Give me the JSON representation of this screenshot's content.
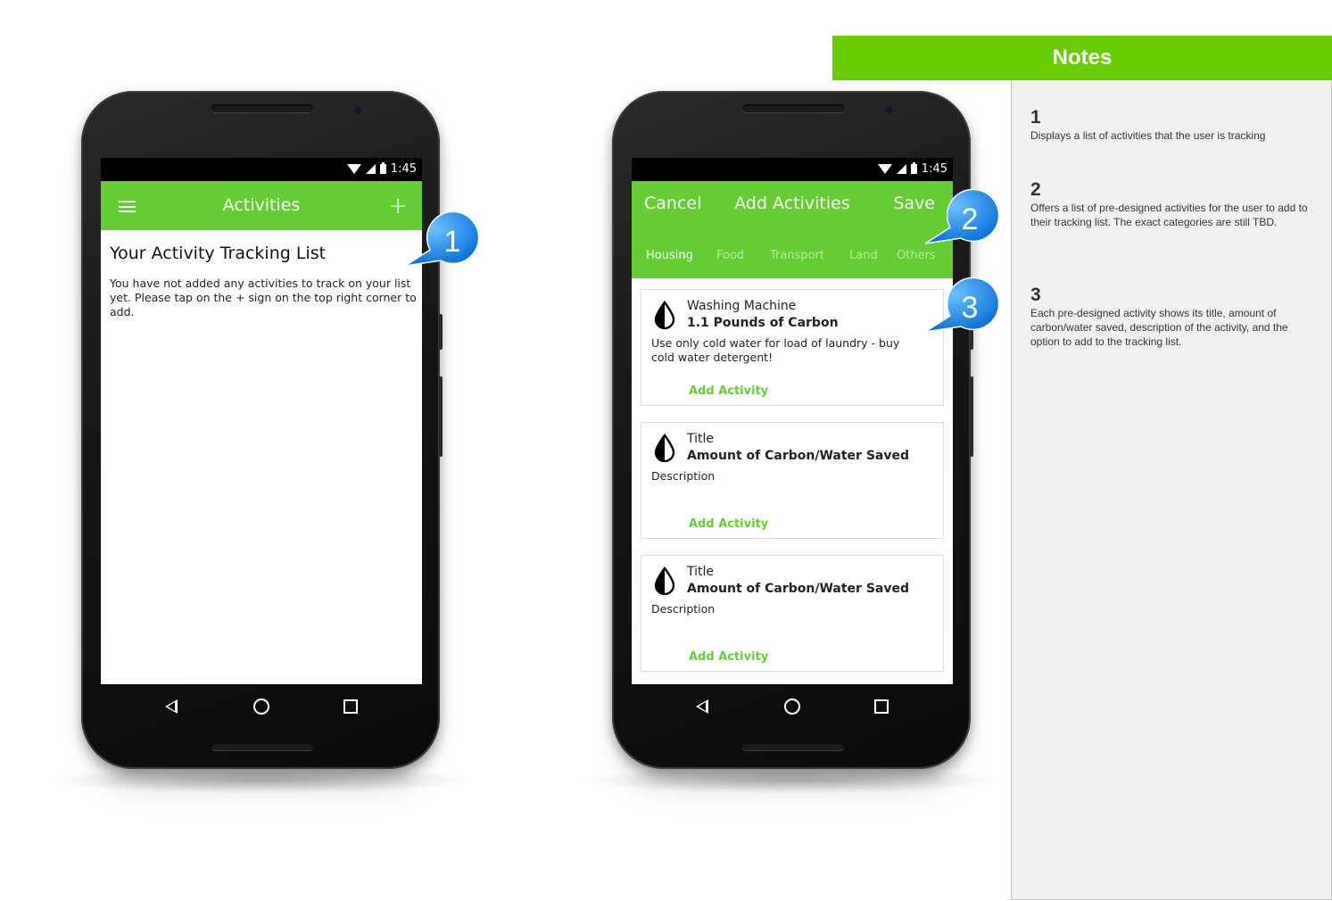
{
  "status": {
    "time": "1:45"
  },
  "screen1": {
    "title": "Activities",
    "heading": "Your Activity Tracking List",
    "message": "You have not added any activities to track on your list yet. Please tap on the + sign on the top right corner to add."
  },
  "screen2": {
    "title": "Add Activities",
    "cancel_label": "Cancel",
    "save_label": "Save",
    "tabs": [
      {
        "label": "Housing"
      },
      {
        "label": "Food"
      },
      {
        "label": "Transport"
      },
      {
        "label": "Land"
      },
      {
        "label": "Others"
      }
    ],
    "cards": [
      {
        "title": "Washing Machine",
        "amount": "1.1 Pounds of Carbon",
        "description": "Use only cold water for load of laundry - buy cold water detergent!",
        "action": "Add Activity"
      },
      {
        "title": "Title",
        "amount": "Amount of Carbon/Water Saved",
        "description": "Description",
        "action": "Add Activity"
      },
      {
        "title": "Title",
        "amount": "Amount of Carbon/Water Saved",
        "description": "Description",
        "action": "Add Activity"
      }
    ]
  },
  "callouts": [
    "1",
    "2",
    "3"
  ],
  "notes": {
    "header": "Notes",
    "items": [
      {
        "number": "1",
        "text": "Displays a list of activities that the user is tracking"
      },
      {
        "number": "2",
        "text": "Offers a list of pre-designed activities for the user to add to their tracking list. The exact categories are still TBD."
      },
      {
        "number": "3",
        "text": "Each pre-designed activity shows its title, amount of carbon/water saved, description of the activity, and the option to add to the tracking list."
      }
    ]
  },
  "colors": {
    "accent": "#66cc33",
    "notes_header": "#66cc00",
    "callout": "#1e8ef0",
    "tab_inactive": "#b7eb99"
  },
  "icons": [
    "menu-icon",
    "plus-icon",
    "wifi-icon",
    "signal-icon",
    "battery-icon",
    "water-drop-icon",
    "back-icon",
    "home-icon",
    "recent-apps-icon"
  ]
}
